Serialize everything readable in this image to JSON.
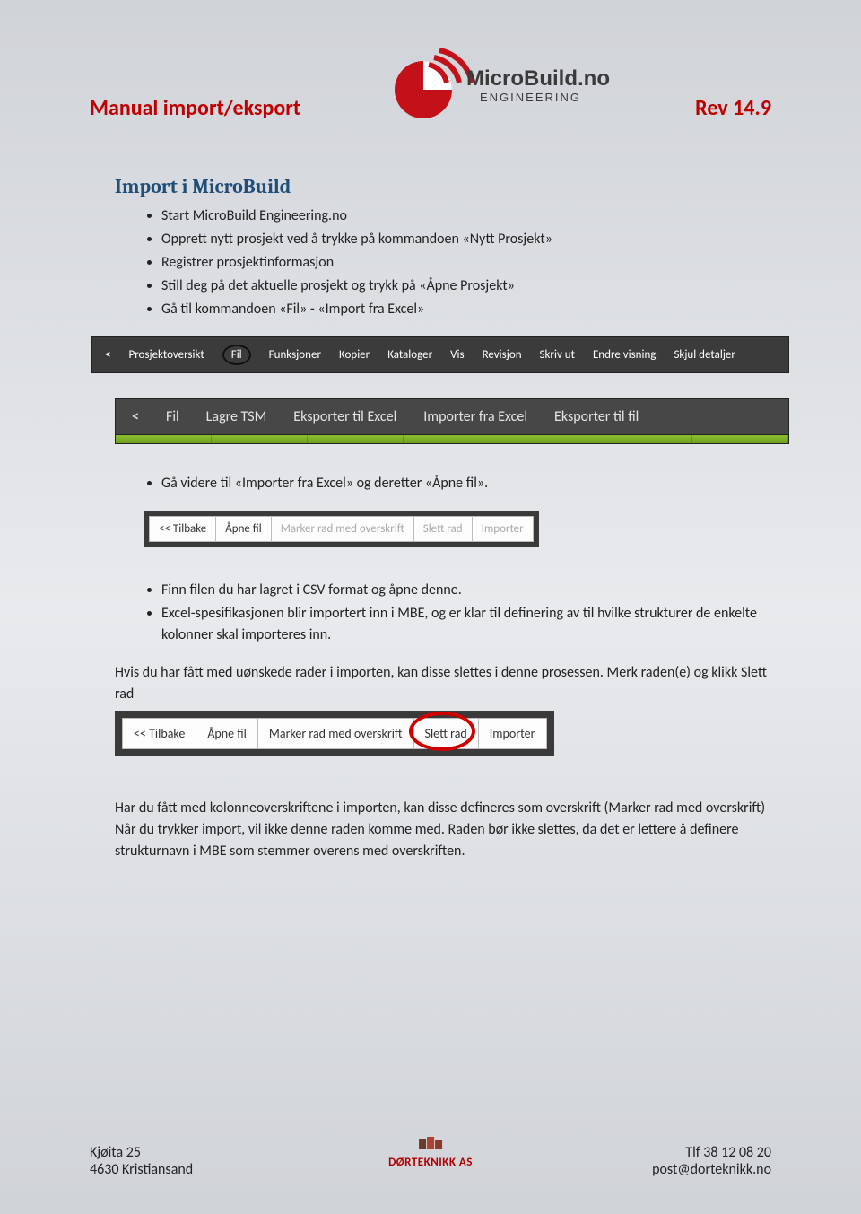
{
  "header": {
    "title_left": "Manual import/eksport",
    "logo_text_top": "MicroBuild.no",
    "logo_text_bottom": "ENGINEERING",
    "title_right": "Rev 14.9"
  },
  "section_title": "Import i MicroBuild",
  "bullets1": [
    "Start MicroBuild Engineering.no",
    "Opprett nytt prosjekt ved å trykke på kommandoen «Nytt Prosjekt»",
    "Registrer prosjektinformasjon",
    "Still deg på det aktuelle prosjekt og trykk på «Åpne Prosjekt»",
    "Gå til kommandoen «Fil» - «Import fra Excel»"
  ],
  "menubar1": {
    "back": "<",
    "items": [
      "Prosjektoversikt",
      "Fil",
      "Funksjoner",
      "Kopier",
      "Kataloger",
      "Vis",
      "Revisjon",
      "Skriv ut",
      "Endre visning",
      "Skjul detaljer"
    ]
  },
  "menubar2": {
    "back": "<",
    "items": [
      "Fil",
      "Lagre TSM",
      "Eksporter til Excel",
      "Importer fra Excel",
      "Eksporter til fil"
    ]
  },
  "bullets2": [
    "Gå videre til «Importer fra Excel» og deretter «Åpne fil»."
  ],
  "toolbar_light": {
    "buttons": [
      "<< Tilbake",
      "Åpne fil",
      "Marker rad med overskrift",
      "Slett rad",
      "Importer"
    ]
  },
  "bullets3": [
    "Finn filen du har lagret i CSV format og åpne denne.",
    "Excel-spesifikasjonen blir importert inn i MBE, og er klar til definering av til hvilke strukturer de enkelte kolonner skal importeres inn."
  ],
  "para1": "Hvis du har fått med uønskede rader i importen, kan disse slettes i denne prosessen. Merk raden(e) og klikk Slett rad",
  "toolbar_highlight": {
    "buttons": [
      "<< Tilbake",
      "Åpne fil",
      "Marker rad med overskrift",
      "Slett rad",
      "Importer"
    ]
  },
  "para2": "Har du fått med kolonneoverskriftene i importen, kan disse defineres som overskrift (Marker rad med overskrift) Når du trykker import, vil ikke denne raden komme med. Raden bør ikke slettes, da det er lettere å definere strukturnavn i MBE som stemmer overens med overskriften.",
  "footer": {
    "left_line1": "Kjøita 25",
    "left_line2": "4630 Kristiansand",
    "center": "DØRTEKNIKK AS",
    "right_line1": "Tlf 38 12 08 20",
    "right_line2": "post@dorteknikk.no"
  }
}
